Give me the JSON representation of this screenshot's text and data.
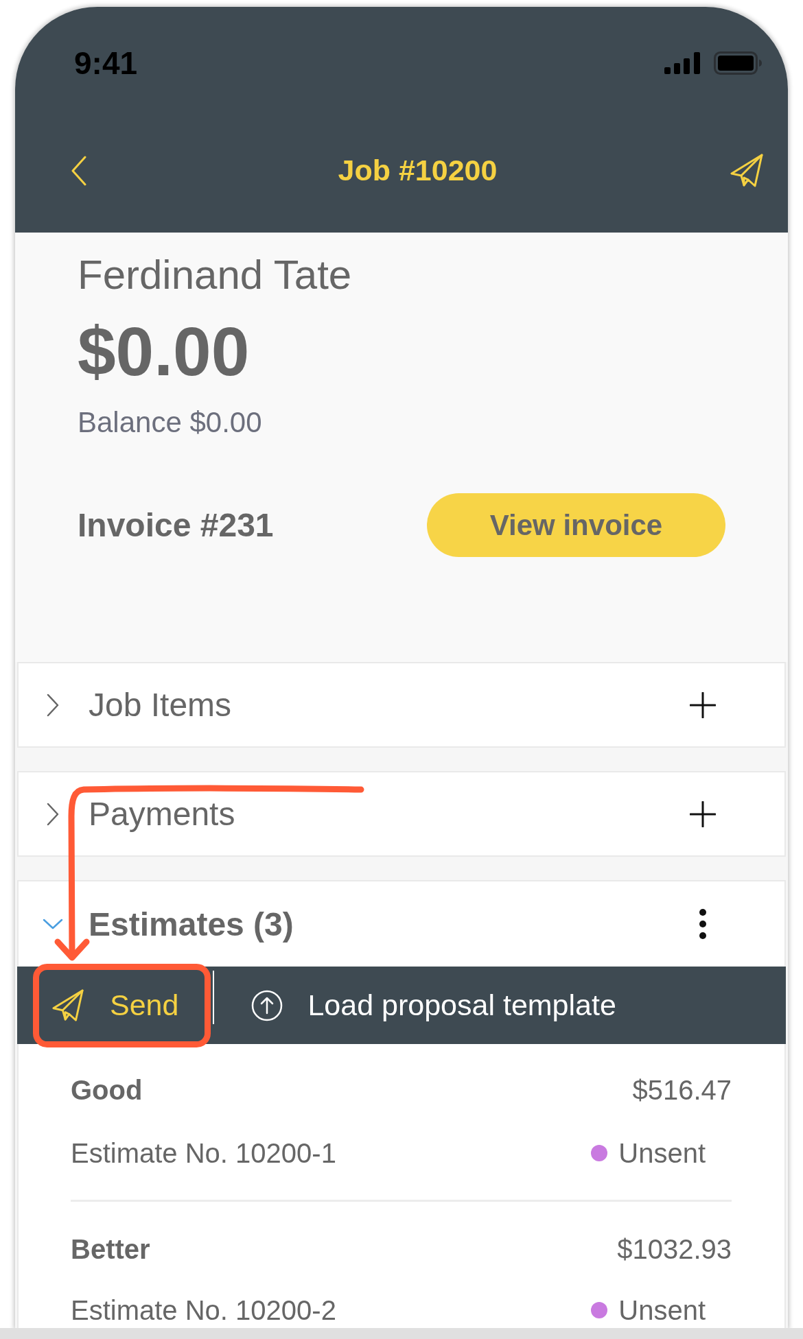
{
  "status_bar": {
    "time": "9:41"
  },
  "nav": {
    "title": "Job #10200"
  },
  "summary": {
    "customer": "Ferdinand Tate",
    "amount": "$0.00",
    "balance": "Balance $0.00",
    "invoice": "Invoice #231",
    "button": "View invoice"
  },
  "sections": [
    {
      "title": "Job Items",
      "expanded": false,
      "kind": "add"
    },
    {
      "title": "Payments",
      "expanded": false,
      "kind": "add"
    },
    {
      "title": "Estimates (3)",
      "expanded": true,
      "kind": "menu",
      "actions": [
        {
          "label": "Send",
          "kind": "send"
        },
        {
          "label": "Load proposal template",
          "kind": "load"
        }
      ],
      "items": [
        {
          "name": "Good",
          "amount": "$516.47",
          "number": "Estimate No. 10200-1",
          "status": "Unsent",
          "color": "#c97ae0"
        },
        {
          "name": "Better",
          "amount": "$1032.93",
          "number": "Estimate No. 10200-2",
          "status": "Unsent",
          "color": "#c97ae0"
        }
      ]
    }
  ]
}
